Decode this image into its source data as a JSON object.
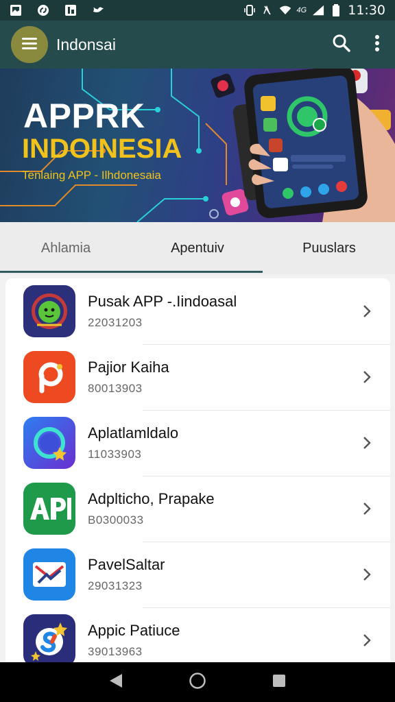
{
  "status_bar": {
    "time": "11:30",
    "network": "4G"
  },
  "app_bar": {
    "title": "Indonsai"
  },
  "banner": {
    "title_line1": "APPRK",
    "title_line2": "INDOINESIA",
    "subtitle": "Tenlaing APP - Ilhdonesaia"
  },
  "tabs": [
    {
      "label": "Ahlamia"
    },
    {
      "label": "Apentuiv"
    },
    {
      "label": "Puuslars"
    }
  ],
  "apps": [
    {
      "name": "Pusak APP -.Iindoasal",
      "number": "22031203",
      "icon": "green-bot-icon"
    },
    {
      "name": "Pajior Kaiha",
      "number": "80013903",
      "icon": "orange-p-icon"
    },
    {
      "name": "Aplatlamldalo",
      "number": "11033903",
      "icon": "ring-star-icon"
    },
    {
      "name": "Adplticho, Prapake",
      "number": "B0300033",
      "icon": "api-icon"
    },
    {
      "name": "PavelSaltar",
      "number": "29031323",
      "icon": "envelope-icon"
    },
    {
      "name": "Appic Patiuce",
      "number": "39013963",
      "icon": "s-star-icon"
    }
  ],
  "colors": {
    "status_bar": "#1d3a3b",
    "app_bar": "#254b4c",
    "accent_banner_text": "#f1c21b",
    "menu_button": "#8a8a3f"
  }
}
